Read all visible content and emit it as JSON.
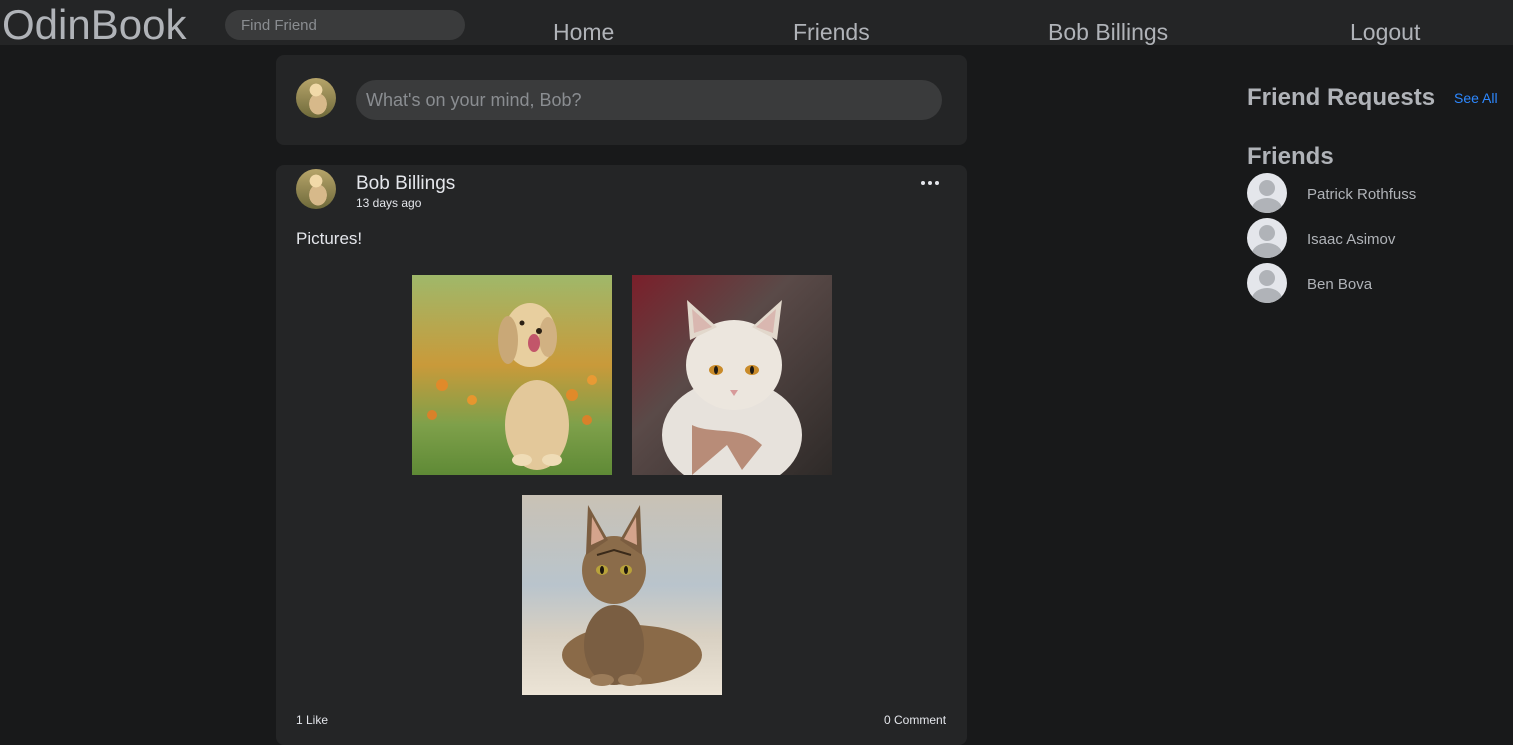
{
  "header": {
    "logo": "OdinBook",
    "search_placeholder": "Find Friend",
    "nav": {
      "home": "Home",
      "friends": "Friends",
      "user": "Bob Billings",
      "logout": "Logout"
    }
  },
  "composer": {
    "placeholder": "What's on your mind, Bob?"
  },
  "post": {
    "author": "Bob Billings",
    "time": "13 days ago",
    "text": "Pictures!",
    "images": [
      "dog-photo",
      "white-cat-photo",
      "tabby-cat-photo"
    ],
    "likes": "1 Like",
    "comments": "0 Comment"
  },
  "sidebar": {
    "friend_requests_title": "Friend Requests",
    "see_all": "See All",
    "friends_title": "Friends",
    "friends": [
      {
        "name": "Patrick Rothfuss"
      },
      {
        "name": "Isaac Asimov"
      },
      {
        "name": "Ben Bova"
      }
    ]
  },
  "colors": {
    "background": "#18191a",
    "card": "#242526",
    "input": "#3a3b3c",
    "link": "#2d88ff",
    "text": "#e4e6eb",
    "muted": "#b0b3b8"
  }
}
